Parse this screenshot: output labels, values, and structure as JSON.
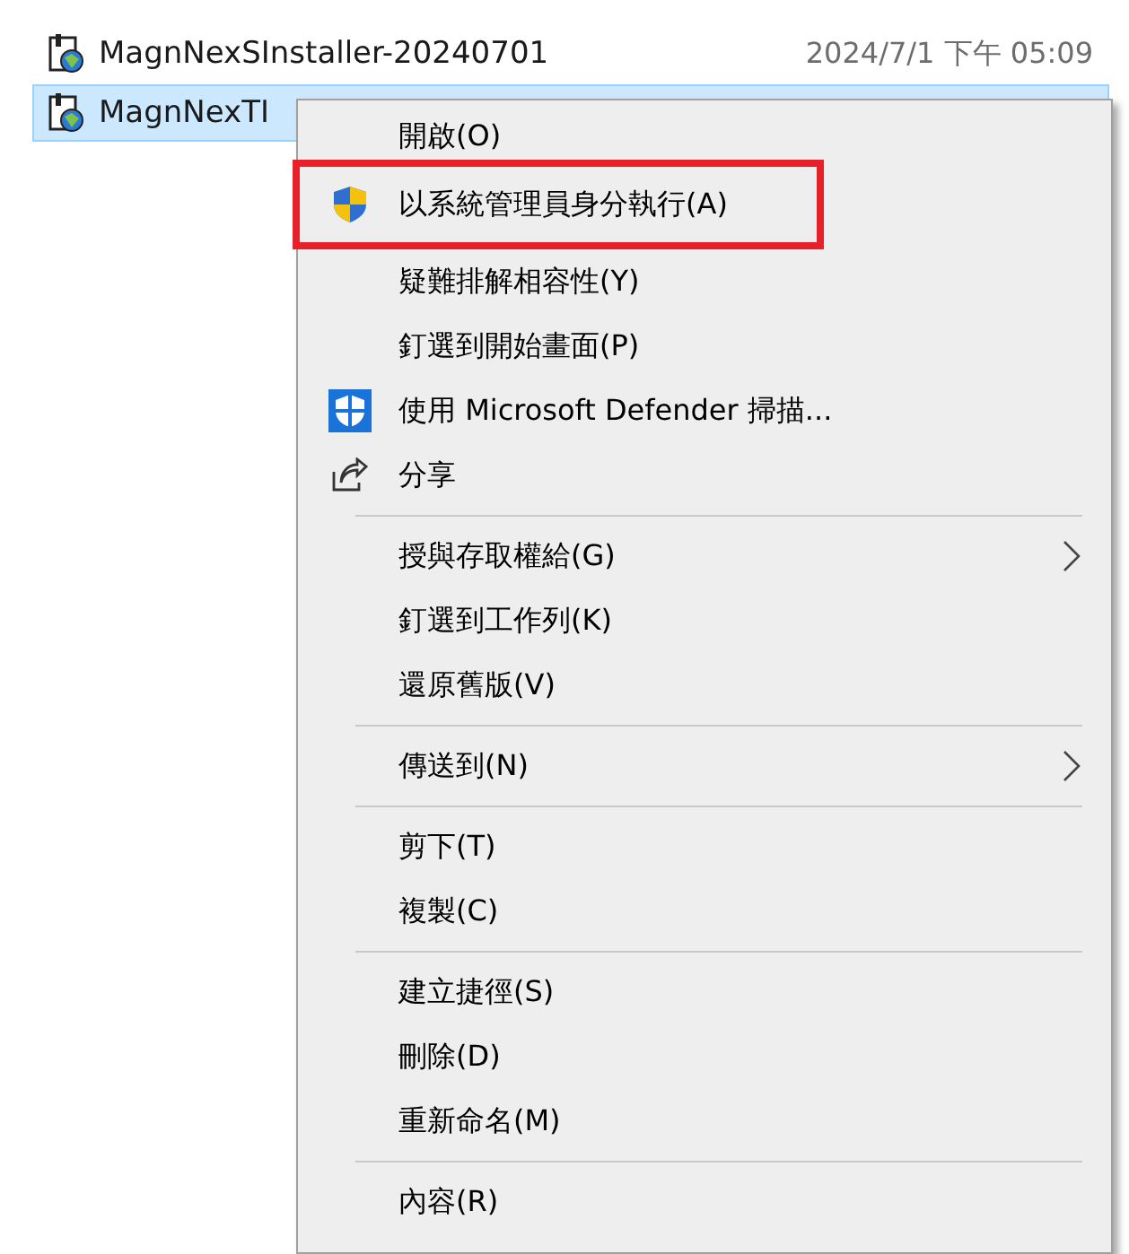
{
  "files": [
    {
      "name": "MagnNexSInstaller-20240701",
      "date": "2024/7/1 下午 05:09",
      "selected": false
    },
    {
      "name": "MagnNexTI",
      "selected": true
    }
  ],
  "menu": {
    "groups": [
      {
        "items": [
          {
            "label": "開啟(O)",
            "kind": "plain",
            "submenu": false,
            "annotated": false
          },
          {
            "label": "以系統管理員身分執行(A)",
            "kind": "uac",
            "submenu": false,
            "annotated": true
          },
          {
            "label": "疑難排解相容性(Y)",
            "kind": "plain",
            "submenu": false,
            "annotated": false
          },
          {
            "label": "釘選到開始畫面(P)",
            "kind": "plain",
            "submenu": false,
            "annotated": false
          },
          {
            "label": "使用 Microsoft Defender 掃描...",
            "kind": "defender",
            "submenu": false,
            "annotated": false
          },
          {
            "label": "分享",
            "kind": "share",
            "submenu": false,
            "annotated": false
          }
        ]
      },
      {
        "items": [
          {
            "label": "授與存取權給(G)",
            "kind": "plain",
            "submenu": true,
            "annotated": false
          },
          {
            "label": "釘選到工作列(K)",
            "kind": "plain",
            "submenu": false,
            "annotated": false
          },
          {
            "label": "還原舊版(V)",
            "kind": "plain",
            "submenu": false,
            "annotated": false
          }
        ]
      },
      {
        "items": [
          {
            "label": "傳送到(N)",
            "kind": "plain",
            "submenu": true,
            "annotated": false
          }
        ]
      },
      {
        "items": [
          {
            "label": "剪下(T)",
            "kind": "plain",
            "submenu": false,
            "annotated": false
          },
          {
            "label": "複製(C)",
            "kind": "plain",
            "submenu": false,
            "annotated": false
          }
        ]
      },
      {
        "items": [
          {
            "label": "建立捷徑(S)",
            "kind": "plain",
            "submenu": false,
            "annotated": false
          },
          {
            "label": "刪除(D)",
            "kind": "plain",
            "submenu": false,
            "annotated": false
          },
          {
            "label": "重新命名(M)",
            "kind": "plain",
            "submenu": false,
            "annotated": false
          }
        ]
      },
      {
        "items": [
          {
            "label": "內容(R)",
            "kind": "plain",
            "submenu": false,
            "annotated": false
          }
        ]
      }
    ]
  }
}
